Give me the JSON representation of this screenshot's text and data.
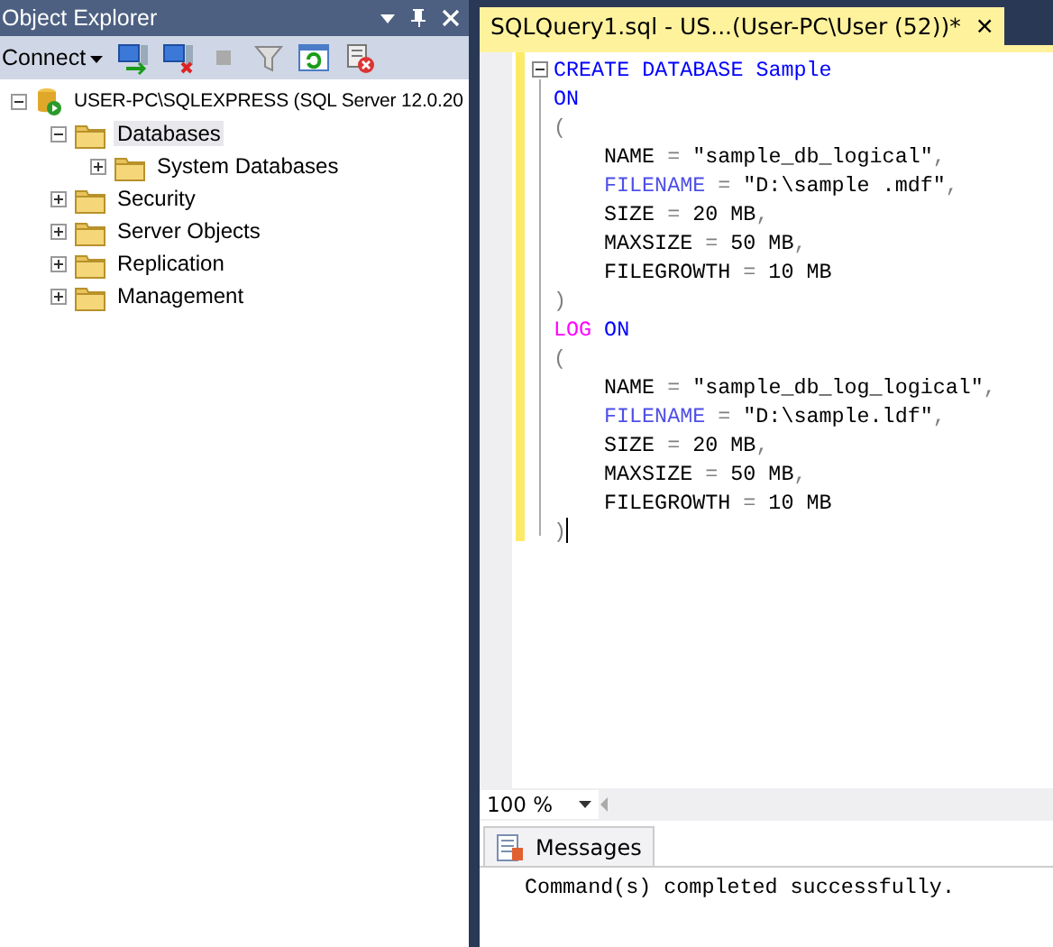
{
  "object_explorer": {
    "title": "Object Explorer",
    "toolbar": {
      "connect": "Connect"
    },
    "tree": [
      {
        "label": "USER-PC\\SQLEXPRESS (SQL Server 12.0.20",
        "kind": "server",
        "expanded": true,
        "selected": false,
        "children": [
          {
            "label": "Databases",
            "kind": "folder",
            "expanded": true,
            "selected": true,
            "children": [
              {
                "label": "System Databases",
                "kind": "folder",
                "expanded": false,
                "selected": false
              }
            ]
          },
          {
            "label": "Security",
            "kind": "folder",
            "expanded": false,
            "selected": false
          },
          {
            "label": "Server Objects",
            "kind": "folder",
            "expanded": false,
            "selected": false
          },
          {
            "label": "Replication",
            "kind": "folder",
            "expanded": false,
            "selected": false
          },
          {
            "label": "Management",
            "kind": "folder",
            "expanded": false,
            "selected": false
          }
        ]
      }
    ]
  },
  "editor": {
    "tab": {
      "title": "SQLQuery1.sql - US...(User-PC\\User (52))*",
      "close": "✕",
      "selected": true
    },
    "lines": [
      {
        "kind": "top",
        "tokens": [
          {
            "text": "CREATE DATABASE Sample",
            "kind": "keyword"
          }
        ]
      },
      {
        "kind": "top",
        "tokens": [
          {
            "text": "ON",
            "kind": "keyword"
          }
        ]
      },
      {
        "kind": "top",
        "tokens": [
          {
            "text": "(",
            "kind": "operator"
          }
        ]
      },
      {
        "kind": "nested",
        "tokens": [
          {
            "text": "NAME ",
            "kind": "text"
          },
          {
            "text": "=",
            "kind": "operator"
          },
          {
            "text": " \"sample_db_logical\"",
            "kind": "text"
          },
          {
            "text": ",",
            "kind": "operator"
          }
        ]
      },
      {
        "kind": "nested",
        "tokens": [
          {
            "text": "FILENAME",
            "kind": "property"
          },
          {
            "text": " = ",
            "kind": "operator"
          },
          {
            "text": "\"D:\\sample .mdf\"",
            "kind": "text"
          },
          {
            "text": ",",
            "kind": "operator"
          }
        ]
      },
      {
        "kind": "nested",
        "tokens": [
          {
            "text": "SIZE ",
            "kind": "text"
          },
          {
            "text": "=",
            "kind": "operator"
          },
          {
            "text": " 20 MB",
            "kind": "text"
          },
          {
            "text": ",",
            "kind": "operator"
          }
        ]
      },
      {
        "kind": "nested",
        "tokens": [
          {
            "text": "MAXSIZE ",
            "kind": "text"
          },
          {
            "text": "=",
            "kind": "operator"
          },
          {
            "text": " 50 MB",
            "kind": "text"
          },
          {
            "text": ",",
            "kind": "operator"
          }
        ]
      },
      {
        "kind": "nested",
        "tokens": [
          {
            "text": "FILEGROWTH ",
            "kind": "text"
          },
          {
            "text": "=",
            "kind": "operator"
          },
          {
            "text": " 10 MB",
            "kind": "text"
          }
        ]
      },
      {
        "kind": "top",
        "tokens": [
          {
            "text": ")",
            "kind": "operator"
          }
        ]
      },
      {
        "kind": "top",
        "tokens": [
          {
            "text": "LOG",
            "kind": "function"
          },
          {
            "text": " ON",
            "kind": "keyword"
          }
        ]
      },
      {
        "kind": "top",
        "tokens": [
          {
            "text": "(",
            "kind": "operator"
          }
        ]
      },
      {
        "kind": "nested",
        "tokens": [
          {
            "text": "NAME ",
            "kind": "text"
          },
          {
            "text": "=",
            "kind": "operator"
          },
          {
            "text": " \"sample_db_log_logical\"",
            "kind": "text"
          },
          {
            "text": ",",
            "kind": "operator"
          }
        ]
      },
      {
        "kind": "nested",
        "tokens": [
          {
            "text": "FILENAME",
            "kind": "property"
          },
          {
            "text": " = ",
            "kind": "operator"
          },
          {
            "text": "\"D:\\sample.ldf\"",
            "kind": "text"
          },
          {
            "text": ",",
            "kind": "operator"
          }
        ]
      },
      {
        "kind": "nested",
        "tokens": [
          {
            "text": "SIZE ",
            "kind": "text"
          },
          {
            "text": "=",
            "kind": "operator"
          },
          {
            "text": " 20 MB",
            "kind": "text"
          },
          {
            "text": ",",
            "kind": "operator"
          }
        ]
      },
      {
        "kind": "nested",
        "tokens": [
          {
            "text": "MAXSIZE ",
            "kind": "text"
          },
          {
            "text": "=",
            "kind": "operator"
          },
          {
            "text": " 50 MB",
            "kind": "text"
          },
          {
            "text": ",",
            "kind": "operator"
          }
        ]
      },
      {
        "kind": "nested",
        "tokens": [
          {
            "text": "FILEGROWTH ",
            "kind": "text"
          },
          {
            "text": "=",
            "kind": "operator"
          },
          {
            "text": " 10 MB",
            "kind": "text"
          }
        ]
      },
      {
        "kind": "top",
        "tokens": [
          {
            "text": ")",
            "kind": "operator"
          }
        ]
      }
    ],
    "zoom": "100 %"
  },
  "results": {
    "tabs": [
      {
        "label": "Messages",
        "selected": true
      }
    ],
    "message": "Command(s) completed successfully."
  }
}
